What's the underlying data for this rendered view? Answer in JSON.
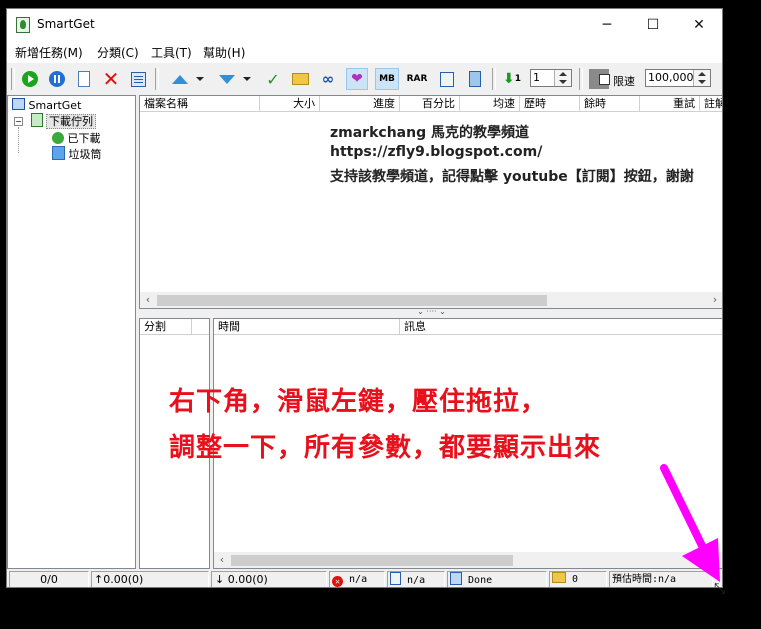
{
  "window": {
    "title": "SmartGet"
  },
  "menu": [
    "新增任務(M)",
    "分類(C)",
    "工具(T)",
    "幫助(H)"
  ],
  "toolbar": {
    "mb_label": "MB",
    "rar_label": "RAR",
    "connections_value": "1",
    "limit_label": "限速",
    "limit_value": "100,000"
  },
  "tree": {
    "root": "SmartGet",
    "queue": "下載佇列",
    "downloaded": "已下載",
    "trash": "垃圾筒"
  },
  "task_columns": [
    "檔案名稱",
    "大小",
    "進度",
    "百分比",
    "均速",
    "歷時",
    "餘時",
    "重試",
    "註解"
  ],
  "splitter_label": "⌄ ···· ⌄",
  "log_columns": {
    "segment": "分割",
    "time": "時間",
    "message": "訊息"
  },
  "watermark": {
    "line1": "zmarkchang 馬克的教學頻道",
    "line2": "https://zfly9.blogspot.com/",
    "line3": "支持該教學頻道，記得點擊 youtube【訂閱】按鈕，謝謝"
  },
  "annotation": {
    "line1": "右下角，滑鼠左鍵，壓住拖拉，",
    "line2": "調整一下，所有參數，都要顯示出來",
    "arrow_color": "#ff00ff"
  },
  "statusbar": {
    "count": "0/0",
    "upload": "↑0.00(0)",
    "download": "↓ 0.00(0)",
    "errors": "n/a",
    "queued": "n/a",
    "state": "Done",
    "folders": "0",
    "eta": "預估時間:n/a"
  }
}
